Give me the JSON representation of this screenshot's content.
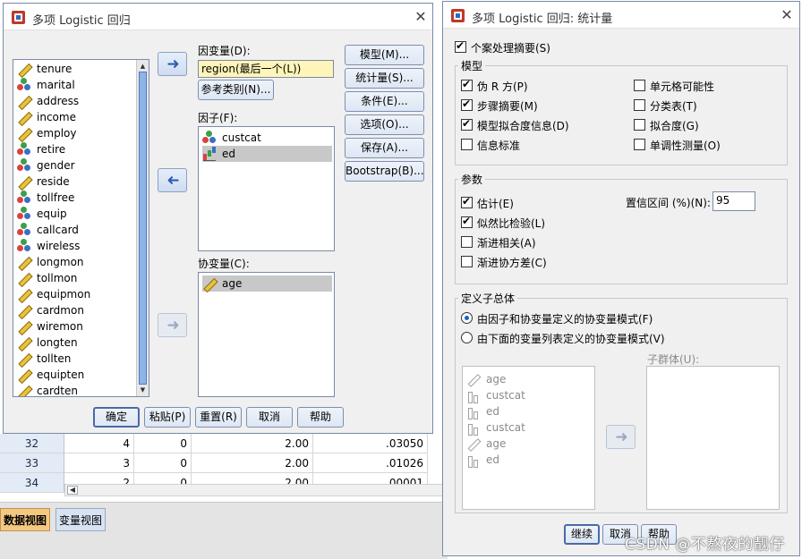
{
  "grid": {
    "rows": [
      {
        "num": "32",
        "c1": "4",
        "c2": "0",
        "c3": "2.00",
        "c4": ".03050"
      },
      {
        "num": "33",
        "c1": "3",
        "c2": "0",
        "c3": "2.00",
        "c4": ".01026"
      },
      {
        "num": "34",
        "c1": "2",
        "c2": "0",
        "c3": "2.00",
        "c4": ".00001"
      }
    ],
    "tab_data": "数据视图",
    "tab_variables": "变量视图"
  },
  "left_dialog": {
    "title": "多项 Logistic 回归",
    "variables": [
      {
        "name": "tenure",
        "type": "scale"
      },
      {
        "name": "marital",
        "type": "nominal"
      },
      {
        "name": "address",
        "type": "scale"
      },
      {
        "name": "income",
        "type": "scale"
      },
      {
        "name": "employ",
        "type": "scale"
      },
      {
        "name": "retire",
        "type": "nominal"
      },
      {
        "name": "gender",
        "type": "nominal"
      },
      {
        "name": "reside",
        "type": "scale"
      },
      {
        "name": "tollfree",
        "type": "nominal"
      },
      {
        "name": "equip",
        "type": "nominal"
      },
      {
        "name": "callcard",
        "type": "nominal"
      },
      {
        "name": "wireless",
        "type": "nominal"
      },
      {
        "name": "longmon",
        "type": "scale"
      },
      {
        "name": "tollmon",
        "type": "scale"
      },
      {
        "name": "equipmon",
        "type": "scale"
      },
      {
        "name": "cardmon",
        "type": "scale"
      },
      {
        "name": "wiremon",
        "type": "scale"
      },
      {
        "name": "longten",
        "type": "scale"
      },
      {
        "name": "tollten",
        "type": "scale"
      },
      {
        "name": "equipten",
        "type": "scale"
      },
      {
        "name": "cardten",
        "type": "scale"
      }
    ],
    "dependent_label": "因变量(D):",
    "dependent_value": "region(最后一个(L))",
    "ref_category_button": "参考类别(N)...",
    "factors_label": "因子(F):",
    "factors": [
      {
        "name": "custcat",
        "type": "nominal"
      },
      {
        "name": "ed",
        "type": "ordinal"
      }
    ],
    "covariates_label": "协变量(C):",
    "covariates": [
      {
        "name": "age",
        "type": "scale"
      }
    ],
    "side_buttons": [
      "模型(M)...",
      "统计量(S)...",
      "条件(E)...",
      "选项(O)...",
      "保存(A)...",
      "Bootstrap(B)..."
    ],
    "bottom_buttons": [
      "确定",
      "粘贴(P)",
      "重置(R)",
      "取消",
      "帮助"
    ],
    "close": "✕"
  },
  "right_dialog": {
    "title": "多项 Logistic 回归: 统计量",
    "case_summary": {
      "label": "个案处理摘要(S)",
      "checked": true
    },
    "model_group": {
      "title": "模型",
      "left": [
        {
          "label": "伪 R 方(P)",
          "checked": true
        },
        {
          "label": "步骤摘要(M)",
          "checked": true
        },
        {
          "label": "模型拟合度信息(D)",
          "checked": true
        },
        {
          "label": "信息标准",
          "checked": false
        }
      ],
      "right": [
        {
          "label": "单元格可能性",
          "checked": false
        },
        {
          "label": "分类表(T)",
          "checked": false
        },
        {
          "label": "拟合度(G)",
          "checked": false
        },
        {
          "label": "单调性测量(O)",
          "checked": false
        }
      ]
    },
    "params_group": {
      "title": "参数",
      "items": [
        {
          "label": "估计(E)",
          "checked": true
        },
        {
          "label": "似然比检验(L)",
          "checked": true
        },
        {
          "label": "渐进相关(A)",
          "checked": false
        },
        {
          "label": "渐进协方差(C)",
          "checked": false
        }
      ],
      "ci_label": "置信区间 (%)(N):",
      "ci_value": "95"
    },
    "subpop_group": {
      "title": "定义子总体",
      "radios": [
        {
          "label": "由因子和协变量定义的协变量模式(F)",
          "checked": true
        },
        {
          "label": "由下面的变量列表定义的协变量模式(V)",
          "checked": false
        }
      ],
      "subgroups_label": "子群体(U):",
      "list": [
        {
          "name": "age",
          "type": "scale"
        },
        {
          "name": "custcat",
          "type": "bar"
        },
        {
          "name": "ed",
          "type": "bar"
        },
        {
          "name": "custcat",
          "type": "bar"
        },
        {
          "name": "age",
          "type": "scale"
        },
        {
          "name": "ed",
          "type": "bar"
        }
      ]
    },
    "bottom_buttons": [
      "继续",
      "取消",
      "帮助"
    ],
    "close": "✕"
  },
  "watermark": "CSDN @不熬夜的靓仔"
}
